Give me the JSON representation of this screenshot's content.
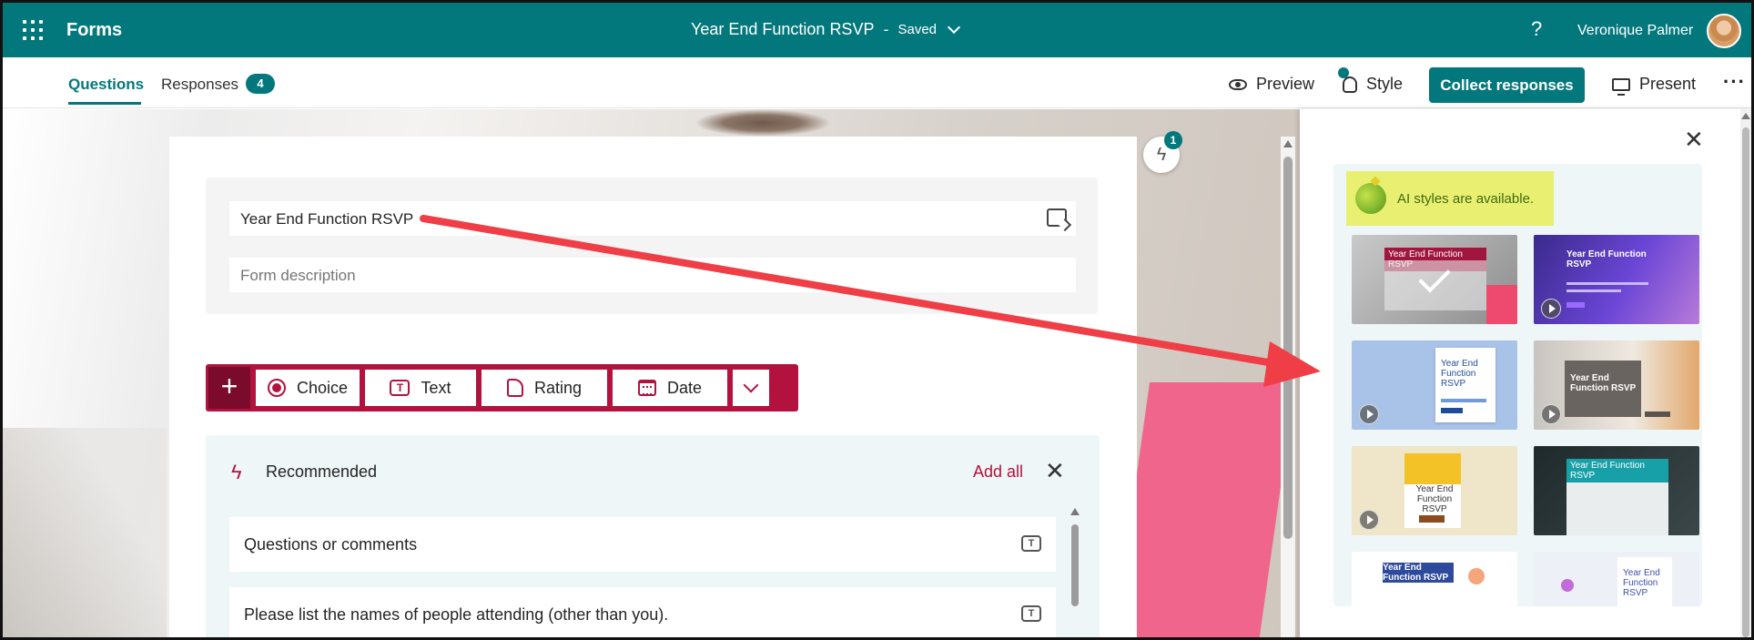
{
  "topbar": {
    "app_name": "Forms",
    "doc_title": "Year End Function RSVP",
    "separator": "-",
    "status": "Saved",
    "help": "?",
    "user_name": "Veronique Palmer"
  },
  "subbar": {
    "questions_tab": "Questions",
    "responses_tab": "Responses",
    "responses_count": "4",
    "preview": "Preview",
    "style": "Style",
    "collect": "Collect responses",
    "present": "Present",
    "more": "···"
  },
  "form": {
    "title_value": "Year End Function RSVP",
    "description_placeholder": "Form description"
  },
  "question_bar": {
    "add": "+",
    "choice": "Choice",
    "text": "Text",
    "rating": "Rating",
    "date": "Date"
  },
  "recommended": {
    "title": "Recommended",
    "add_all": "Add all",
    "items": [
      {
        "label": "Questions or comments"
      },
      {
        "label": "Please list the names of people attending (other than you)."
      }
    ]
  },
  "ideas_badge": "1",
  "style_panel": {
    "ai_banner": "AI styles are available.",
    "theme_label": "Year End Function RSVP"
  },
  "colors": {
    "brand": "#03787c",
    "accent": "#b3123f",
    "arrow": "#ef3e45"
  }
}
